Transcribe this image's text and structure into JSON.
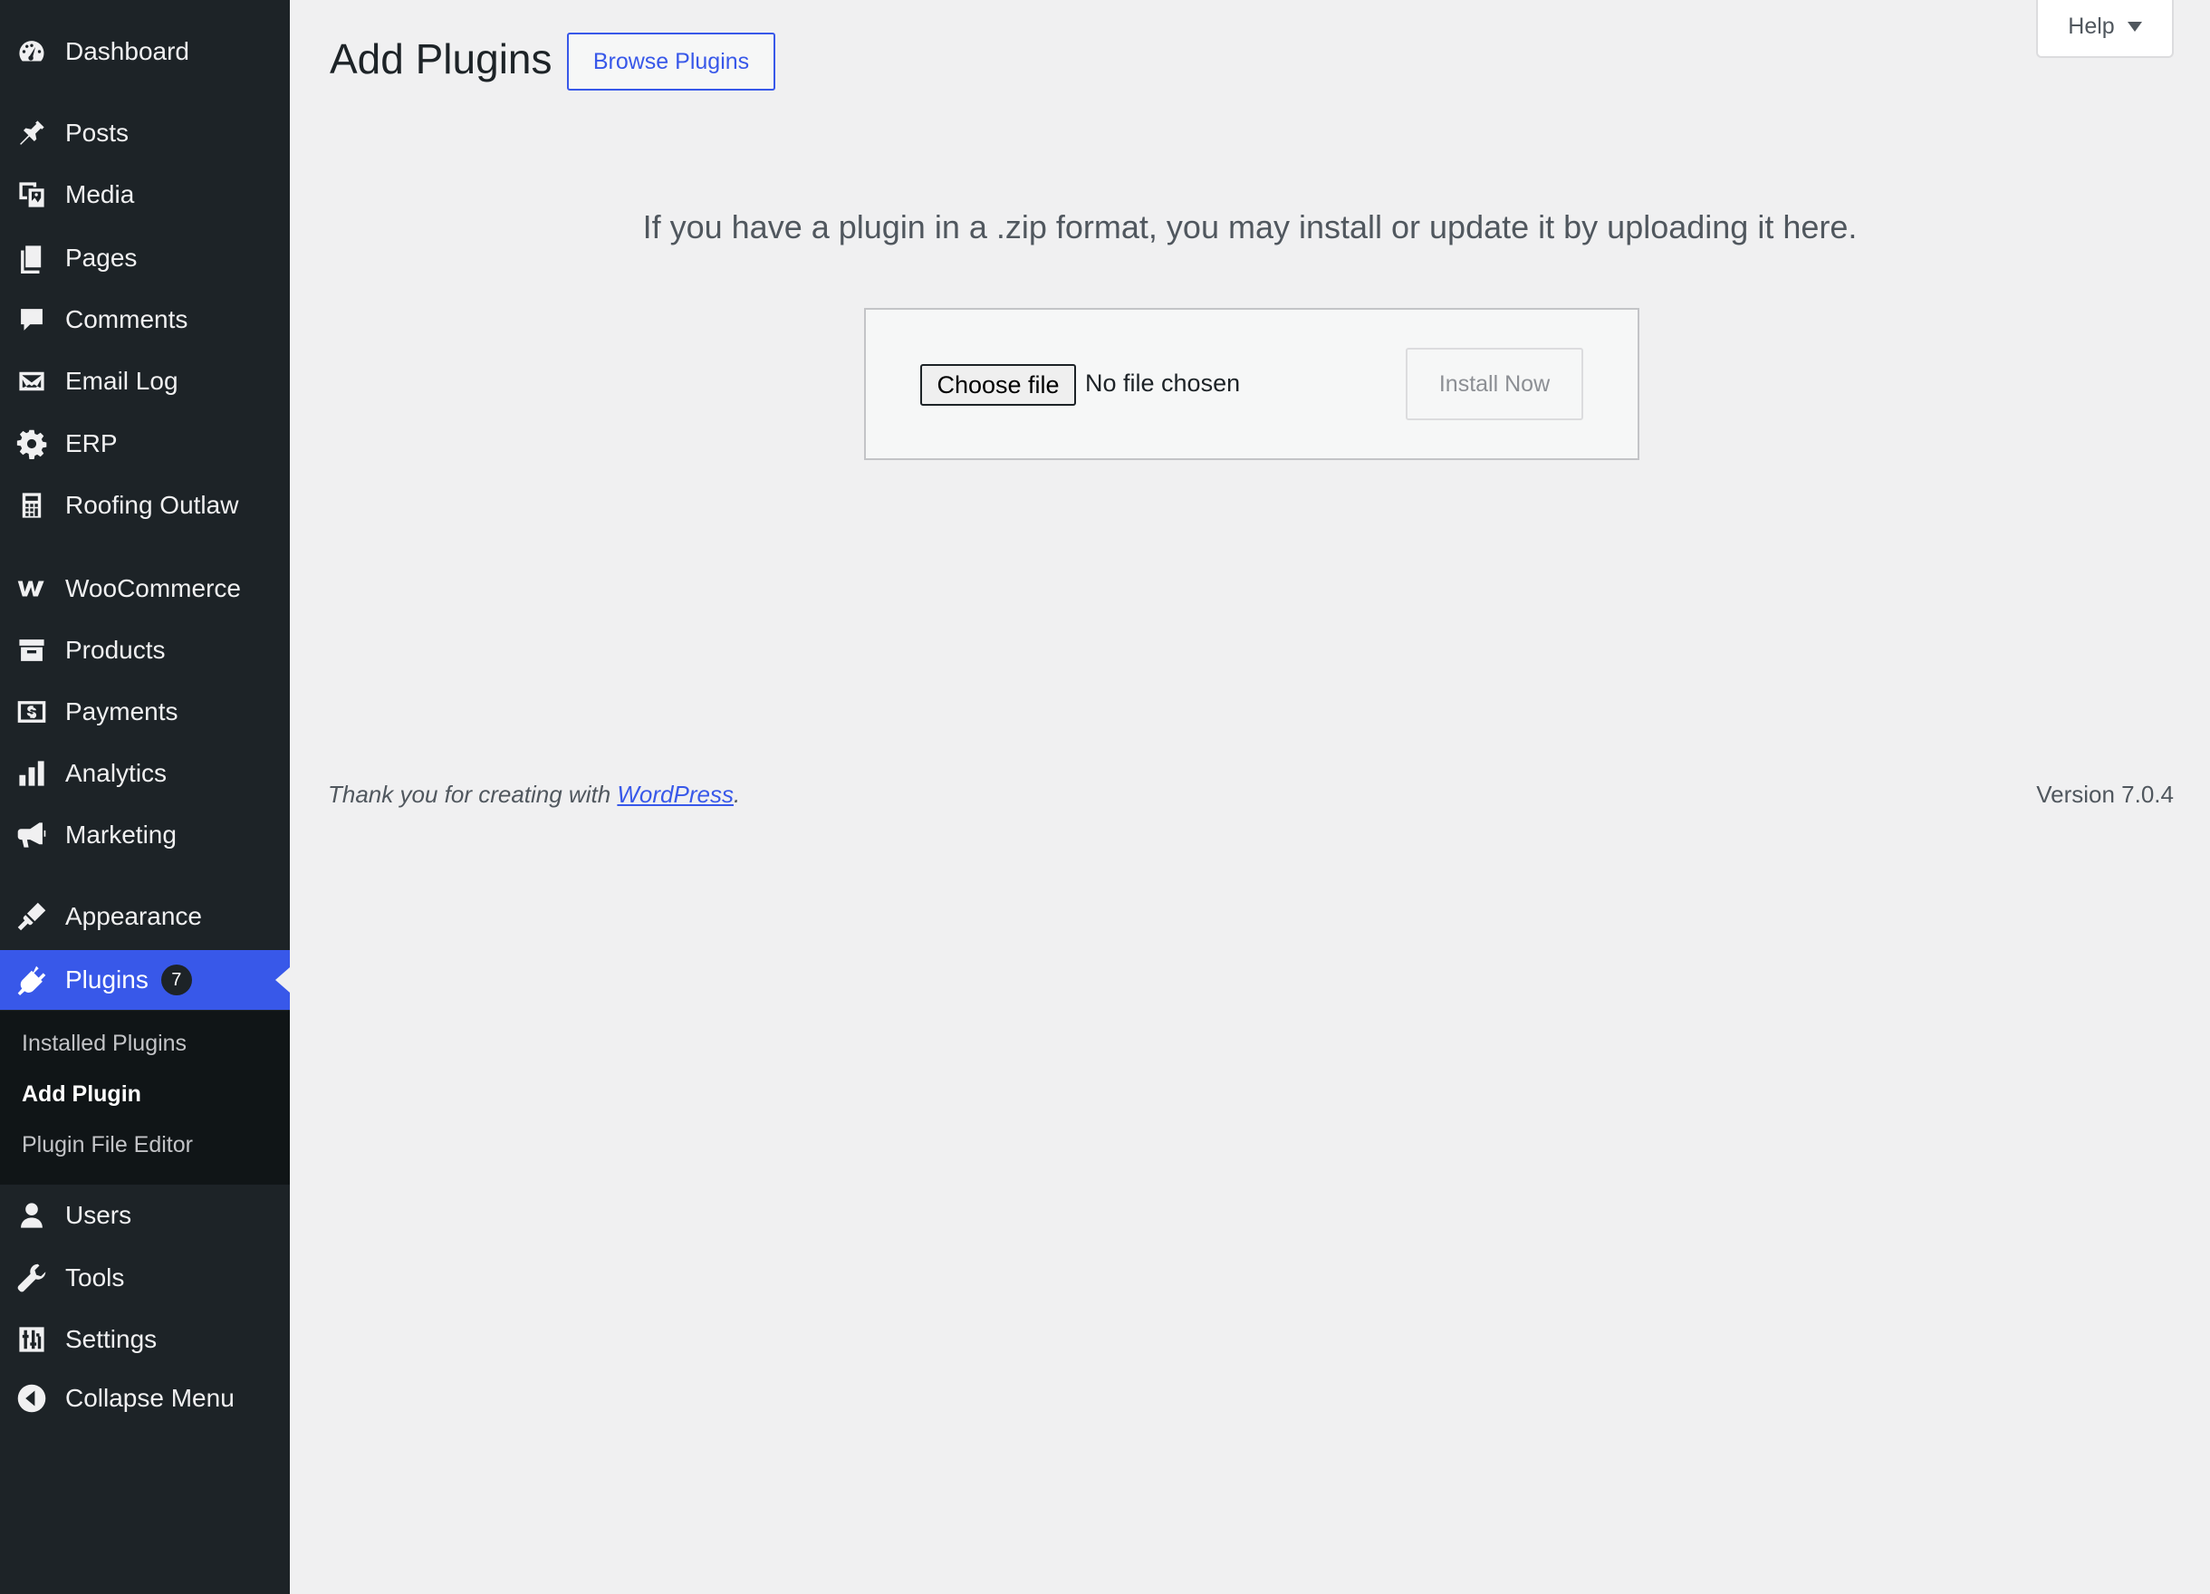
{
  "page": {
    "title": "Add Plugins",
    "browse_label": "Browse Plugins",
    "help_label": "Help"
  },
  "sidebar": {
    "items": [
      {
        "label": "Dashboard",
        "icon": "dashboard-icon"
      },
      {
        "label": "Posts",
        "icon": "pin-icon"
      },
      {
        "label": "Media",
        "icon": "media-icon"
      },
      {
        "label": "Pages",
        "icon": "pages-icon"
      },
      {
        "label": "Comments",
        "icon": "comment-icon"
      },
      {
        "label": "Email Log",
        "icon": "email-icon"
      },
      {
        "label": "ERP",
        "icon": "gear-icon"
      },
      {
        "label": "Roofing Outlaw",
        "icon": "calculator-icon"
      },
      {
        "label": "WooCommerce",
        "icon": "woocommerce-icon"
      },
      {
        "label": "Products",
        "icon": "archive-icon"
      },
      {
        "label": "Payments",
        "icon": "dollar-icon"
      },
      {
        "label": "Analytics",
        "icon": "bar-chart-icon"
      },
      {
        "label": "Marketing",
        "icon": "megaphone-icon"
      },
      {
        "label": "Appearance",
        "icon": "brush-icon"
      },
      {
        "label": "Plugins",
        "icon": "plugin-icon",
        "badge": "7",
        "current": true
      },
      {
        "label": "Users",
        "icon": "user-icon"
      },
      {
        "label": "Tools",
        "icon": "wrench-icon"
      },
      {
        "label": "Settings",
        "icon": "sliders-icon"
      },
      {
        "label": "Collapse Menu",
        "icon": "collapse-icon"
      }
    ],
    "submenu": [
      {
        "label": "Installed Plugins"
      },
      {
        "label": "Add Plugin",
        "active": true
      },
      {
        "label": "Plugin File Editor"
      }
    ]
  },
  "upload": {
    "description": "If you have a plugin in a .zip format, you may install or update it by uploading it here.",
    "choose_file_label": "Choose file",
    "file_status": "No file chosen",
    "install_label": "Install Now"
  },
  "footer": {
    "thanks_text": "Thank you for creating with ",
    "wordpress_link": "WordPress",
    "period": ".",
    "version": "Version 7.0.4"
  },
  "colors": {
    "sidebar_bg": "#1d2327",
    "accent": "#3858e9",
    "page_bg": "#f0f0f1"
  }
}
